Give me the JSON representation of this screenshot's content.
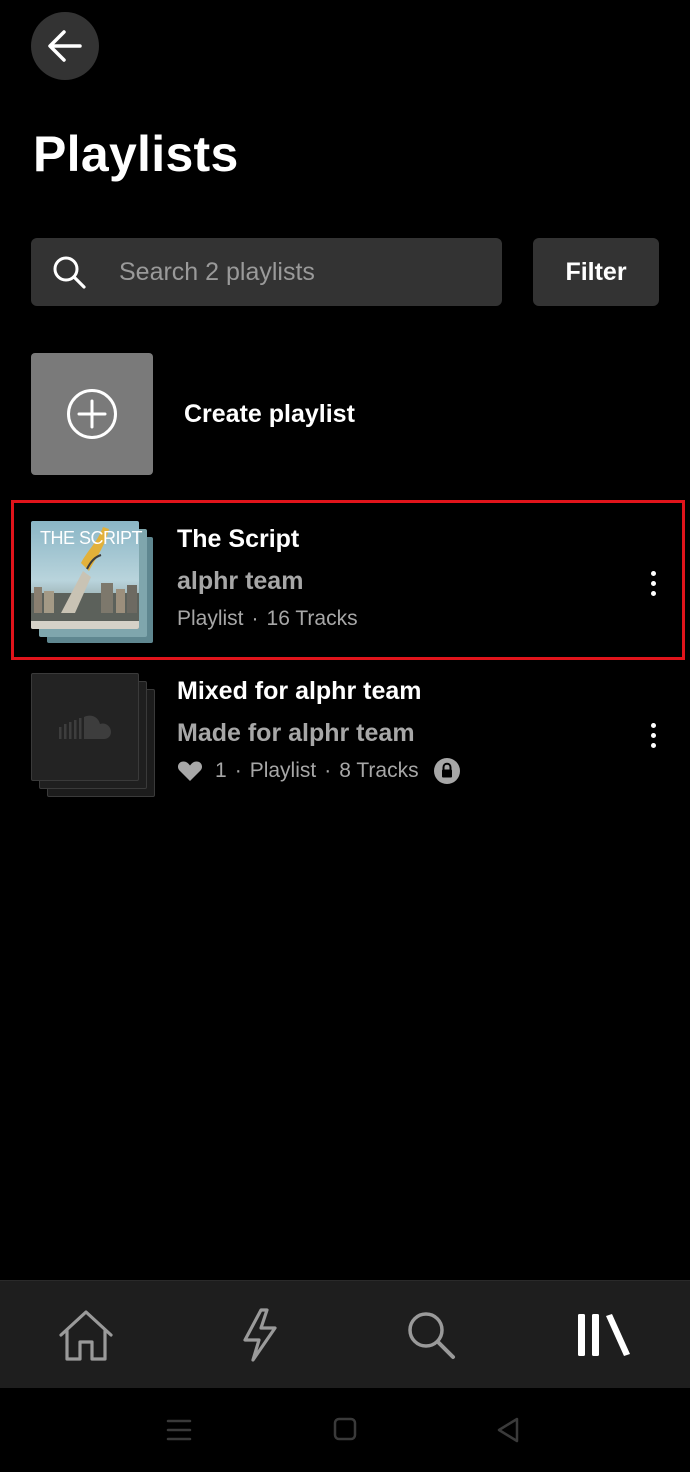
{
  "header": {
    "title": "Playlists"
  },
  "search": {
    "placeholder": "Search 2 playlists",
    "value": ""
  },
  "filter": {
    "label": "Filter"
  },
  "create": {
    "label": "Create playlist"
  },
  "playlists": [
    {
      "title": "The Script",
      "owner": "alphr team",
      "meta_type": "Playlist",
      "meta_tracks": "16 Tracks",
      "cover_text": "THE SCRIPT",
      "highlighted": true
    },
    {
      "title": "Mixed for alphr team",
      "owner": "Made for alphr team",
      "likes": "1",
      "meta_type": "Playlist",
      "meta_tracks": "8 Tracks",
      "private": true,
      "highlighted": false
    }
  ],
  "nav": {
    "items": [
      "home-icon",
      "lightning-icon",
      "search-icon",
      "library-icon"
    ],
    "active": "library-icon"
  },
  "system_nav": [
    "menu-icon",
    "home-square-icon",
    "back-triangle-icon"
  ],
  "colors": {
    "background": "#000000",
    "surface": "#333333",
    "secondary_text": "#a7a7a7",
    "highlight": "#e0141b"
  }
}
